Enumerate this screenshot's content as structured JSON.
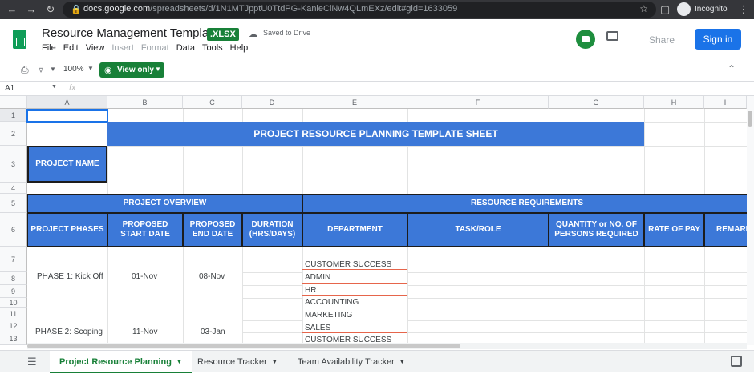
{
  "browser": {
    "url_domain": "docs.google.com",
    "url_path": "/spreadsheets/d/1N1MTJpptU0TtdPG-KanieClNw4QLmEXz/edit#gid=1633059",
    "incognito_label": "Incognito"
  },
  "app": {
    "title": "Resource Management Template",
    "file_badge": ".XLSX",
    "save_status": "Saved to Drive",
    "menus": [
      "File",
      "Edit",
      "View",
      "Insert",
      "Format",
      "Data",
      "Tools",
      "Help"
    ],
    "share_label": "Share",
    "signin_label": "Sign in"
  },
  "toolbar": {
    "zoom": "100%",
    "view_only_label": "View only"
  },
  "formula_bar": {
    "cell_ref": "A1",
    "fx": "fx"
  },
  "grid": {
    "columns": [
      "A",
      "B",
      "C",
      "D",
      "E",
      "F",
      "G",
      "H",
      "I"
    ],
    "rows": [
      "1",
      "2",
      "3",
      "4",
      "5",
      "6",
      "7",
      "8",
      "9",
      "10",
      "11",
      "12",
      "13"
    ],
    "sheet_title": "PROJECT RESOURCE PLANNING TEMPLATE SHEET",
    "project_name_label": "PROJECT NAME",
    "project_overview": "PROJECT OVERVIEW",
    "resource_requirements": "RESOURCE REQUIREMENTS",
    "headers": [
      "PROJECT PHASES",
      "PROPOSED START DATE",
      "PROPOSED END DATE",
      "DURATION (HRS/DAYS)",
      "DEPARTMENT",
      "TASK/ROLE",
      "QUANTITY or NO. OF PERSONS REQUIRED",
      "RATE OF PAY",
      "REMARK"
    ],
    "phases": [
      {
        "name": "PHASE 1: Kick Off",
        "start": "01-Nov",
        "end": "08-Nov"
      },
      {
        "name": "PHASE 2: Scoping",
        "start": "11-Nov",
        "end": "03-Jan"
      }
    ],
    "departments": [
      "CUSTOMER SUCCESS",
      "ADMIN",
      "HR",
      "ACCOUNTING",
      "MARKETING",
      "SALES",
      "CUSTOMER SUCCESS"
    ]
  },
  "tabs": [
    {
      "label": "Project Resource Planning",
      "active": true
    },
    {
      "label": "Resource Tracker",
      "active": false
    },
    {
      "label": "Team Availability Tracker",
      "active": false
    }
  ],
  "colors": {
    "header_blue": "#3c78d8",
    "sheets_green": "#188038",
    "signin_blue": "#1a73e8",
    "dept_underline": "#e6654b"
  }
}
